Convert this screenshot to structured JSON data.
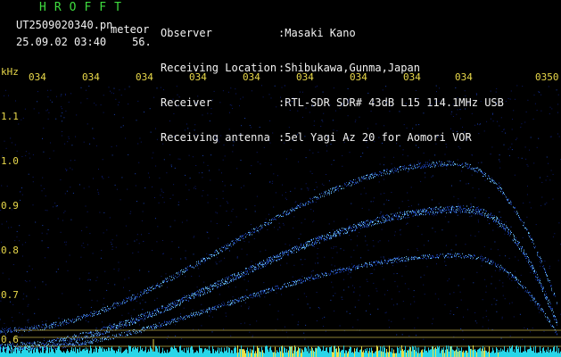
{
  "header": {
    "title": "HROFFT",
    "filename": "UT2509020340.pn",
    "filename_suffix": "meteor",
    "datetime": "25.09.02 03:40",
    "extra_value": "56."
  },
  "meta": {
    "labels": [
      "Observer",
      "Receiving Location",
      "Receiver",
      "Receiving antenna"
    ],
    "values": [
      ":Masaki Kano",
      ":Shibukawa,Gunma,Japan",
      ":RTL-SDR SDR# 43dB L15 114.1MHz USB",
      ":5el Yagi Az 20 for Aomori VOR"
    ]
  },
  "axes": {
    "unit_label": "kHz",
    "time_ticks": [
      "034",
      "034",
      "034",
      "034",
      "034",
      "034",
      "034",
      "034",
      "034",
      "0350"
    ],
    "freq_ticks": [
      "1.1",
      "1.0",
      "0.9",
      "0.8",
      "0.7",
      "0.6"
    ]
  },
  "colors": {
    "background": "#000000",
    "signal_bright": "#6fc8ff",
    "signal_dim": "#1a3fb0",
    "noise": "#0d1a6b",
    "axis_text": "#e8d84a",
    "header_green": "#3fdc3f",
    "baseline_cyan": "#27d6e8"
  }
}
